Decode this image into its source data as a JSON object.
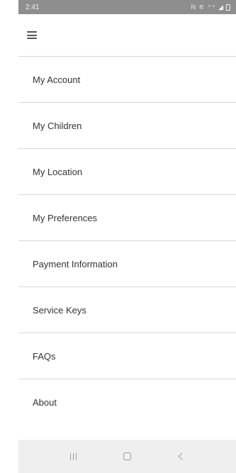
{
  "status_bar": {
    "time": "2:41",
    "icons_text": "N ⚟ ⁺⁺ ◢"
  },
  "app_bar": {
    "menu_icon": "hamburger-menu-icon"
  },
  "menu": {
    "items": [
      {
        "label": "My Account"
      },
      {
        "label": "My Children"
      },
      {
        "label": "My Location"
      },
      {
        "label": "My Preferences"
      },
      {
        "label": "Payment Information"
      },
      {
        "label": "Service Keys"
      },
      {
        "label": "FAQs"
      },
      {
        "label": "About"
      }
    ]
  },
  "nav_bar": {
    "recents_icon": "recents-icon",
    "home_icon": "home-icon",
    "back_icon": "back-icon"
  },
  "colors": {
    "status_bar_bg": "#8e8e8e",
    "nav_bar_bg": "#efefef",
    "divider": "#d8d8d8",
    "text": "#333333"
  }
}
